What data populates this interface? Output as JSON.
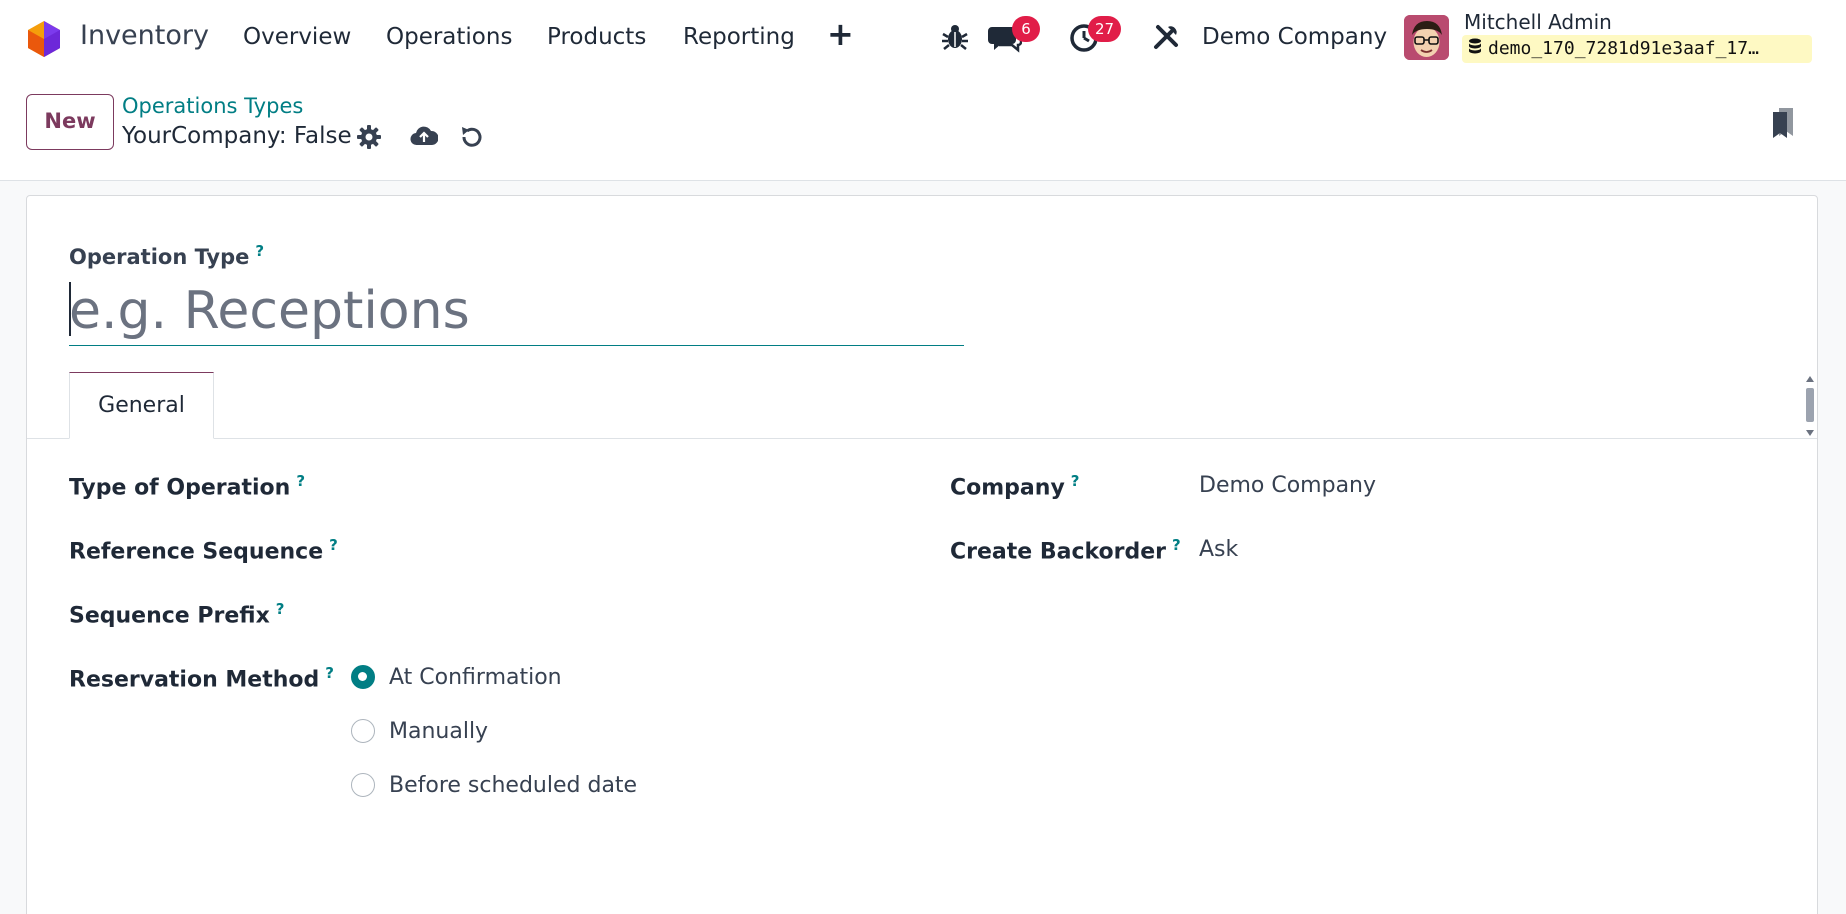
{
  "navbar": {
    "app_name": "Inventory",
    "menu": [
      "Overview",
      "Operations",
      "Products",
      "Reporting"
    ],
    "plus_icon": "plus-icon",
    "messages_badge": "6",
    "activities_badge": "27",
    "company": "Demo Company",
    "user_name": "Mitchell Admin",
    "database": "demo_170_7281d91e3aaf_17…"
  },
  "control_panel": {
    "new_label": "New",
    "breadcrumb": "Operations Types",
    "record_name": "YourCompany: False"
  },
  "form": {
    "operation_type_label": "Operation Type",
    "help_mark": "?",
    "title_placeholder": "e.g. Receptions",
    "tab_general": "General",
    "type_of_operation_label": "Type of Operation",
    "reference_sequence_label": "Reference Sequence",
    "sequence_prefix_label": "Sequence Prefix",
    "reservation_method_label": "Reservation Method",
    "reservation_options": [
      "At Confirmation",
      "Manually",
      "Before scheduled date"
    ],
    "reservation_selected": "At Confirmation",
    "company_label": "Company",
    "company_value": "Demo Company",
    "create_backorder_label": "Create Backorder",
    "create_backorder_value": "Ask"
  },
  "colors": {
    "accent_teal": "#017e84",
    "brand_purple": "#7c3a5e",
    "badge_red": "#e11d48"
  }
}
